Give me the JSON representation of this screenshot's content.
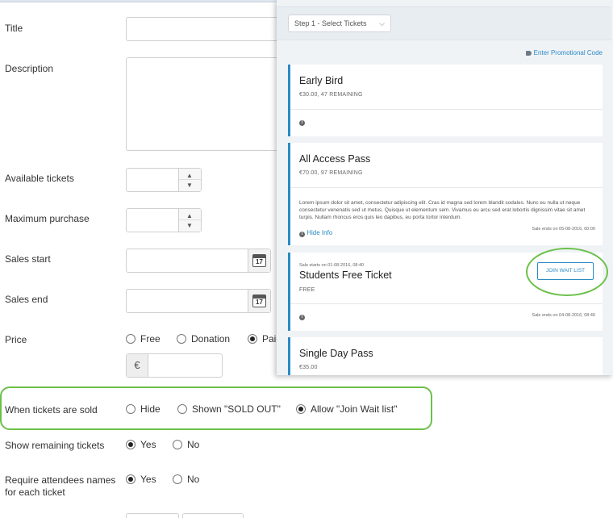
{
  "form": {
    "title_label": "Title",
    "description_label": "Description",
    "available_tickets_label": "Available tickets",
    "maximum_purchase_label": "Maximum purchase",
    "sales_start_label": "Sales start",
    "sales_end_label": "Sales end",
    "calendar_day": "17",
    "price": {
      "label": "Price",
      "options": [
        "Free",
        "Donation",
        "Paid"
      ],
      "selected": "Paid",
      "currency_symbol": "€"
    },
    "when_sold": {
      "label": "When tickets are sold",
      "options": [
        "Hide",
        "Shown \"SOLD OUT\"",
        "Allow \"Join Wait list\""
      ],
      "selected": "Allow \"Join Wait list\""
    },
    "show_remaining": {
      "label": "Show remaining tickets",
      "options": [
        "Yes",
        "No"
      ],
      "selected": "Yes"
    },
    "require_names": {
      "label": "Require attendees names for each ticket",
      "options": [
        "Yes",
        "No"
      ],
      "selected": "Yes"
    }
  },
  "preview": {
    "step_select": "Step 1 - Select Tickets",
    "promo_link": "Enter Promotional Code",
    "tickets": [
      {
        "name": "Early Bird",
        "price_line": "€30.00, 47 REMAINING"
      },
      {
        "name": "All Access Pass",
        "price_line": "€70.00, 97 REMAINING",
        "description": "Lorem ipsum dolor sit amet, consectetur adipiscing elit. Cras id magna sed lorem blandit sodales. Nunc eu nulla ut neque consectetur venenatis sed ut metus. Quisque ut elementum sem. Vivamus eu arcu sed erat lobortis dignissim vitae sit amet turpis. Nullam rhoncus eros quis leo dapibus, eu porta tortor interdum.",
        "hide_info": "Hide Info",
        "sale_ends": "Sale ends on 05-08-2016, 00:00"
      },
      {
        "name": "Students Free Ticket",
        "price_line": "FREE",
        "sale_starts": "Sale starts on 01-08-2016, 08:40",
        "sale_ends": "Sale ends on 04-08-2016, 08:40",
        "button": "JOIN WAIT LIST"
      },
      {
        "name": "Single Day Pass",
        "price_line": "€35.00"
      }
    ]
  },
  "colors": {
    "accent": "#2a8ac4",
    "highlight": "#6cc04a"
  }
}
